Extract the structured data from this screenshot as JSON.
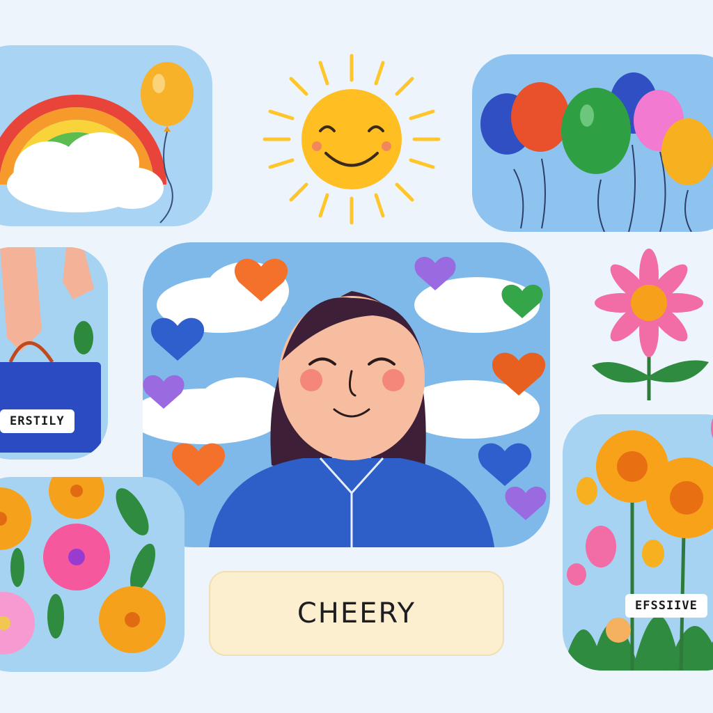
{
  "labels": {
    "bag_tag": "ERSTILY",
    "center_word": "CHEERY",
    "flowers_tag": "EFSSIIVE"
  },
  "colors": {
    "sky": "#8fc5ee",
    "background": "#eef4fb",
    "sun": "#ffbe22",
    "shirt": "#2e5ec7",
    "hair": "#3d1f38",
    "skin": "#f7bda0",
    "pill": "#fcefcf"
  },
  "icons": [
    "rainbow-icon",
    "sun-icon",
    "balloon-icon",
    "heart-icon",
    "flower-icon",
    "cloud-icon",
    "shopping-bag-icon"
  ]
}
